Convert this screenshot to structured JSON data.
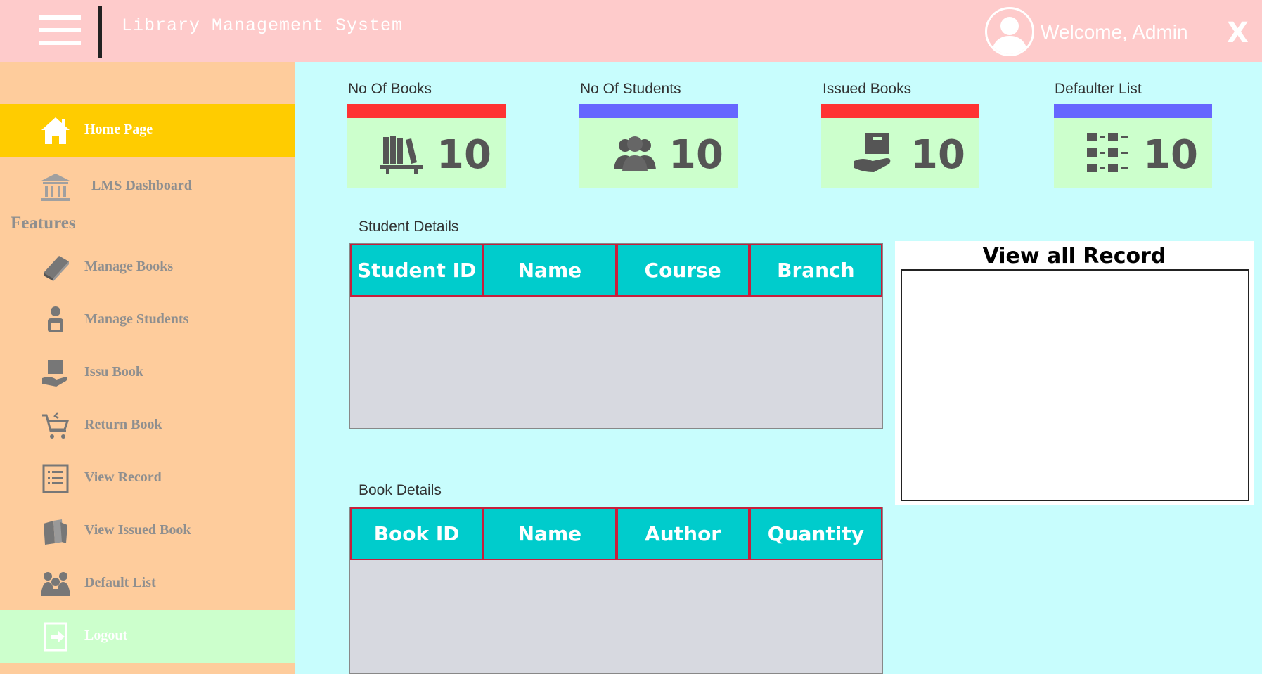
{
  "header": {
    "title": "Library Management System",
    "welcome": "Welcome, Admin",
    "close_label": "X"
  },
  "sidebar": {
    "home": "Home Page",
    "dashboard": "LMS Dashboard",
    "features_heading": "Features",
    "items": [
      {
        "label": "Manage Books",
        "icon": "book-icon"
      },
      {
        "label": "Manage Students",
        "icon": "student-icon"
      },
      {
        "label": "Issu Book",
        "icon": "issue-book-icon"
      },
      {
        "label": "Return Book",
        "icon": "cart-return-icon"
      },
      {
        "label": "View Record",
        "icon": "list-icon"
      },
      {
        "label": "View Issued Book",
        "icon": "books-stack-icon"
      },
      {
        "label": "Default List",
        "icon": "group-icon"
      }
    ],
    "logout": "Logout"
  },
  "stats": [
    {
      "title": "No Of Books",
      "value": "10",
      "bar_color": "#ff3333",
      "icon": "bookshelf-icon"
    },
    {
      "title": "No Of Students",
      "value": "10",
      "bar_color": "#6666ff",
      "icon": "users-icon"
    },
    {
      "title": "Issued Books",
      "value": "10",
      "bar_color": "#ff3333",
      "icon": "hand-box-icon"
    },
    {
      "title": "Defaulter List",
      "value": "10",
      "bar_color": "#6666ff",
      "icon": "checklist-icon"
    }
  ],
  "student_details": {
    "title": "Student Details",
    "columns": [
      "Student ID",
      "Name",
      "Course",
      "Branch"
    ]
  },
  "book_details": {
    "title": "Book Details",
    "columns": [
      "Book ID",
      "Name",
      "Author",
      "Quantity"
    ]
  },
  "record_panel": {
    "title": "View all Record"
  },
  "colors": {
    "header_bg": "#fecbcb",
    "sidebar_bg": "#fecc9c",
    "active_item": "#ffcc00",
    "logout_bg": "#ccffcc",
    "content_bg": "#c8fdfd",
    "table_header": "#00cccc"
  }
}
